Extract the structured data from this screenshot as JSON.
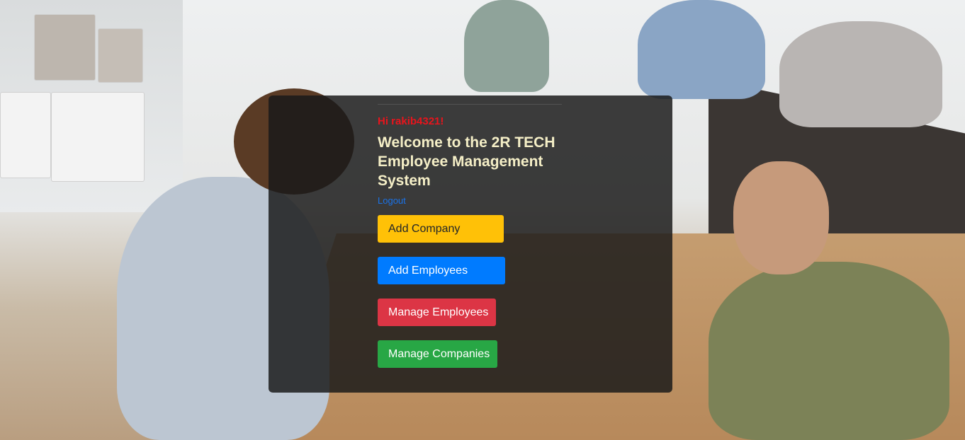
{
  "greeting": "Hi rakib4321!",
  "heading": "Welcome to the 2R TECH Employee Management System",
  "logout_label": "Logout",
  "buttons": {
    "add_company": "Add Company",
    "add_employees": "Add Employees",
    "manage_employees": "Manage Employees",
    "manage_companies": "Manage Companies"
  },
  "colors": {
    "greeting": "#e8141c",
    "heading": "#f5efc7",
    "link": "#1a73e8",
    "warning": "#ffc107",
    "primary": "#007bff",
    "danger": "#dc3545",
    "success": "#28a745"
  }
}
